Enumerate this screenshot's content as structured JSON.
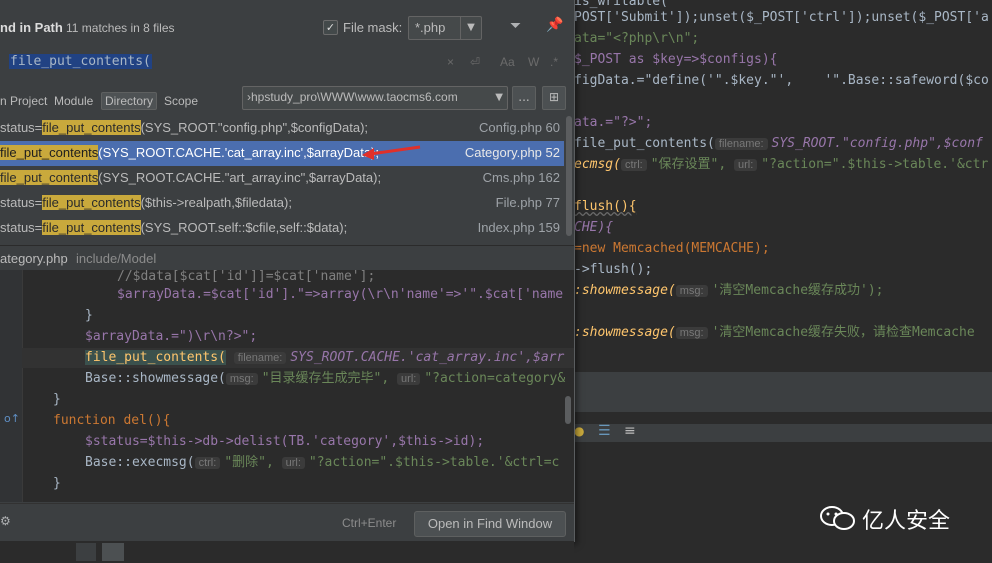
{
  "popup": {
    "title": "nd in Path",
    "matches": "11 matches in 8 files",
    "file_mask_label": "File mask:",
    "file_mask_checked": "✓",
    "file_mask_value": "*.php",
    "search_query": "file_put_contents(",
    "search_controls": [
      "×",
      "⏎",
      "Aa",
      "W",
      ".*"
    ],
    "scope_tabs": [
      "n Project",
      "Module",
      "Directory",
      "Scope"
    ],
    "active_scope": "Directory",
    "directory": "›hpstudy_pro\\WWW\\www.taocms6.com",
    "directory_button": "...",
    "results": [
      {
        "prefix": "status=",
        "match": "file_put_contents",
        "rest": "(SYS_ROOT.\"config.php\",$configData);",
        "file": "Config.php 60"
      },
      {
        "prefix": "",
        "match": "file_put_contents",
        "rest": "(SYS_ROOT.CACHE.'cat_array.inc',$arrayData);",
        "file": "Category.php 52"
      },
      {
        "prefix": "",
        "match": "file_put_contents",
        "rest": "(SYS_ROOT.CACHE.\"art_array.inc\",$arrayData);",
        "file": "Cms.php 162"
      },
      {
        "prefix": "status=",
        "match": "file_put_contents",
        "rest": "($this->realpath,$filedata);",
        "file": "File.php 77"
      },
      {
        "prefix": "status=",
        "match": "file_put_contents",
        "rest": "(SYS_ROOT.self::$cfile,self::$data);",
        "file": "Index.php 159"
      }
    ],
    "preview_file": "ategory.php",
    "preview_path": "include/Model",
    "shortcut": "Ctrl+Enter",
    "open_button": "Open in Find Window"
  },
  "preview_code": [
    "//$data[$cat['id']]=$cat['name'];",
    "$arrayData.=$cat['id'].\"=>array(\\r\\n'name'=>'\".$cat['name",
    "}",
    "$arrayData.=\")\\r\\n?>\";",
    "file_put_contents(",
    "Base::showmessage(",
    "}",
    "function del(){",
    "$status=$this->db->delist(TB.'category',$this->id);",
    "Base::execmsg(",
    "}"
  ],
  "editor_right": [
    "is_writable(",
    "POST['Submit']);unset($_POST['ctrl']);unset($_POST['a",
    "ata=\"<?php\\r\\n\";",
    "$_POST as $key=>$configs){",
    "figData.=\"define('\".$key.\"',    '\".Base::safeword($co",
    "ata.=\"?>\";",
    "file_put_contents(",
    "ecmsg(",
    "flush(){",
    "CHE){",
    "=new Memcached(MEMCACHE);",
    "->flush();",
    ":showmessage(",
    ":showmessage("
  ],
  "hints": {
    "filename": "filename:",
    "msg": "msg:",
    "url": "url:",
    "ctrl": "ctrl:"
  },
  "preview_strings": {
    "fpc_args": "SYS_ROOT.CACHE.'cat_array.inc',$arr",
    "msg1": "\"目录缓存生成完毕\",",
    "url1": "\"?action=category&",
    "ctrl_del": "\"删除\",",
    "url_del": "\"?action=\".$this->table.'&ctrl=c"
  },
  "right_strings": {
    "fpc_config": "SYS_ROOT.\"config.php\",$conf",
    "ecmsg_text": "\"保存设置\",",
    "ecmsg_url": "\"?action=\".$this->table.'&ctr",
    "mem_ok": "'清空Memcache缓存成功');",
    "mem_fail": "'清空Memcache缓存失败，请检查Memcache"
  },
  "watermark": "亿人安全",
  "colors": {
    "accent_selected": "#4b6eaf",
    "match_highlight": "#c9a93c",
    "arrow_red": "#e0302a"
  }
}
